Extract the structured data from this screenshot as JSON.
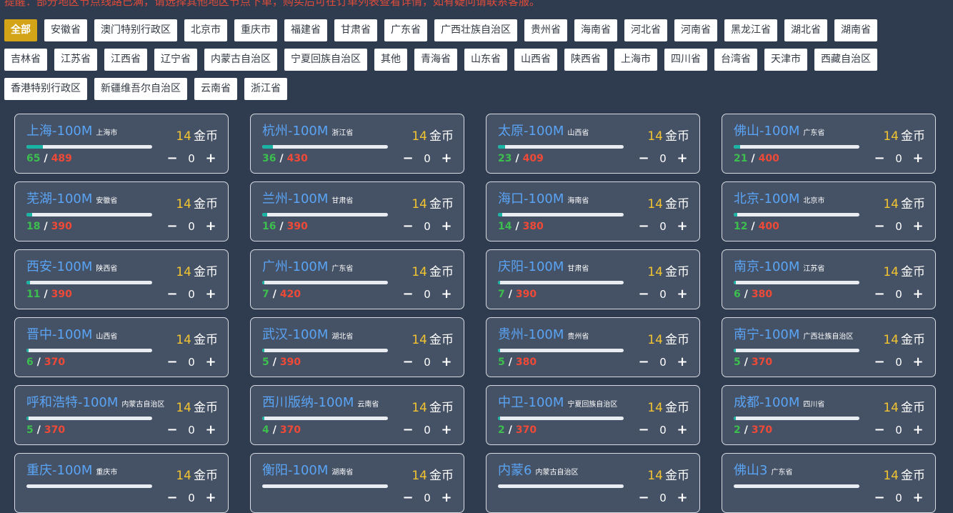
{
  "notice": "提醒：部分地区节点线路已满，请选择其他地区节点下单，购买后可在订单列表查看详情，如有疑问请联系客服。",
  "filters": [
    {
      "label": "全部",
      "active": true
    },
    {
      "label": "安徽省"
    },
    {
      "label": "澳门特别行政区"
    },
    {
      "label": "北京市"
    },
    {
      "label": "重庆市"
    },
    {
      "label": "福建省"
    },
    {
      "label": "甘肃省"
    },
    {
      "label": "广东省"
    },
    {
      "label": "广西壮族自治区"
    },
    {
      "label": "贵州省"
    },
    {
      "label": "海南省"
    },
    {
      "label": "河北省"
    },
    {
      "label": "河南省"
    },
    {
      "label": "黑龙江省"
    },
    {
      "label": "湖北省"
    },
    {
      "label": "湖南省"
    },
    {
      "label": "吉林省"
    },
    {
      "label": "江苏省"
    },
    {
      "label": "江西省"
    },
    {
      "label": "辽宁省"
    },
    {
      "label": "内蒙古自治区"
    },
    {
      "label": "宁夏回族自治区"
    },
    {
      "label": "其他"
    },
    {
      "label": "青海省"
    },
    {
      "label": "山东省"
    },
    {
      "label": "山西省"
    },
    {
      "label": "陕西省"
    },
    {
      "label": "上海市"
    },
    {
      "label": "四川省"
    },
    {
      "label": "台湾省"
    },
    {
      "label": "天津市"
    },
    {
      "label": "西藏自治区"
    },
    {
      "label": "香港特别行政区"
    },
    {
      "label": "新疆维吾尔自治区"
    },
    {
      "label": "云南省"
    },
    {
      "label": "浙江省"
    }
  ],
  "price_unit": "金币",
  "cards": [
    {
      "city": "上海-100M",
      "province": "上海市",
      "price": "14",
      "used": 65,
      "total": 489,
      "qty": "0"
    },
    {
      "city": "杭州-100M",
      "province": "浙江省",
      "price": "14",
      "used": 36,
      "total": 430,
      "qty": "0"
    },
    {
      "city": "太原-100M",
      "province": "山西省",
      "price": "14",
      "used": 23,
      "total": 409,
      "qty": "0"
    },
    {
      "city": "佛山-100M",
      "province": "广东省",
      "price": "14",
      "used": 21,
      "total": 400,
      "qty": "0"
    },
    {
      "city": "芜湖-100M",
      "province": "安徽省",
      "price": "14",
      "used": 18,
      "total": 390,
      "qty": "0"
    },
    {
      "city": "兰州-100M",
      "province": "甘肃省",
      "price": "14",
      "used": 16,
      "total": 390,
      "qty": "0"
    },
    {
      "city": "海口-100M",
      "province": "海南省",
      "price": "14",
      "used": 14,
      "total": 380,
      "qty": "0"
    },
    {
      "city": "北京-100M",
      "province": "北京市",
      "price": "14",
      "used": 12,
      "total": 400,
      "qty": "0"
    },
    {
      "city": "西安-100M",
      "province": "陕西省",
      "price": "14",
      "used": 11,
      "total": 390,
      "qty": "0"
    },
    {
      "city": "广州-100M",
      "province": "广东省",
      "price": "14",
      "used": 7,
      "total": 420,
      "qty": "0"
    },
    {
      "city": "庆阳-100M",
      "province": "甘肃省",
      "price": "14",
      "used": 7,
      "total": 390,
      "qty": "0"
    },
    {
      "city": "南京-100M",
      "province": "江苏省",
      "price": "14",
      "used": 6,
      "total": 380,
      "qty": "0"
    },
    {
      "city": "晋中-100M",
      "province": "山西省",
      "price": "14",
      "used": 6,
      "total": 370,
      "qty": "0"
    },
    {
      "city": "武汉-100M",
      "province": "湖北省",
      "price": "14",
      "used": 5,
      "total": 390,
      "qty": "0"
    },
    {
      "city": "贵州-100M",
      "province": "贵州省",
      "price": "14",
      "used": 5,
      "total": 380,
      "qty": "0"
    },
    {
      "city": "南宁-100M",
      "province": "广西壮族自治区",
      "price": "14",
      "used": 5,
      "total": 370,
      "qty": "0"
    },
    {
      "city": "呼和浩特-100M",
      "province": "内蒙古自治区",
      "price": "14",
      "used": 5,
      "total": 370,
      "qty": "0"
    },
    {
      "city": "西川版纳-100M",
      "province": "云南省",
      "price": "14",
      "used": 4,
      "total": 370,
      "qty": "0"
    },
    {
      "city": "中卫-100M",
      "province": "宁夏回族自治区",
      "price": "14",
      "used": 2,
      "total": 370,
      "qty": "0"
    },
    {
      "city": "成都-100M",
      "province": "四川省",
      "price": "14",
      "used": 2,
      "total": 370,
      "qty": "0"
    },
    {
      "city": "重庆-100M",
      "province": "重庆市",
      "price": "14",
      "used": null,
      "total": null,
      "qty": "0"
    },
    {
      "city": "衡阳-100M",
      "province": "湖南省",
      "price": "14",
      "used": null,
      "total": null,
      "qty": "0"
    },
    {
      "city": "内蒙6",
      "province": "内蒙古自治区",
      "price": "14",
      "used": null,
      "total": null,
      "qty": "0"
    },
    {
      "city": "佛山3",
      "province": "广东省",
      "price": "14",
      "used": null,
      "total": null,
      "qty": "0"
    }
  ],
  "colors": {
    "background": "#2f3c4f",
    "card_bg": "#455165",
    "city_blue": "#5aa4f5",
    "price_yellow": "#f3c431",
    "used_green": "#3cbf4e",
    "total_red": "#ef4937",
    "bar_fill": "#19b4a4",
    "active_chip": "#d4a418"
  },
  "icons": {
    "decrement": "minus-icon",
    "increment": "plus-icon"
  }
}
